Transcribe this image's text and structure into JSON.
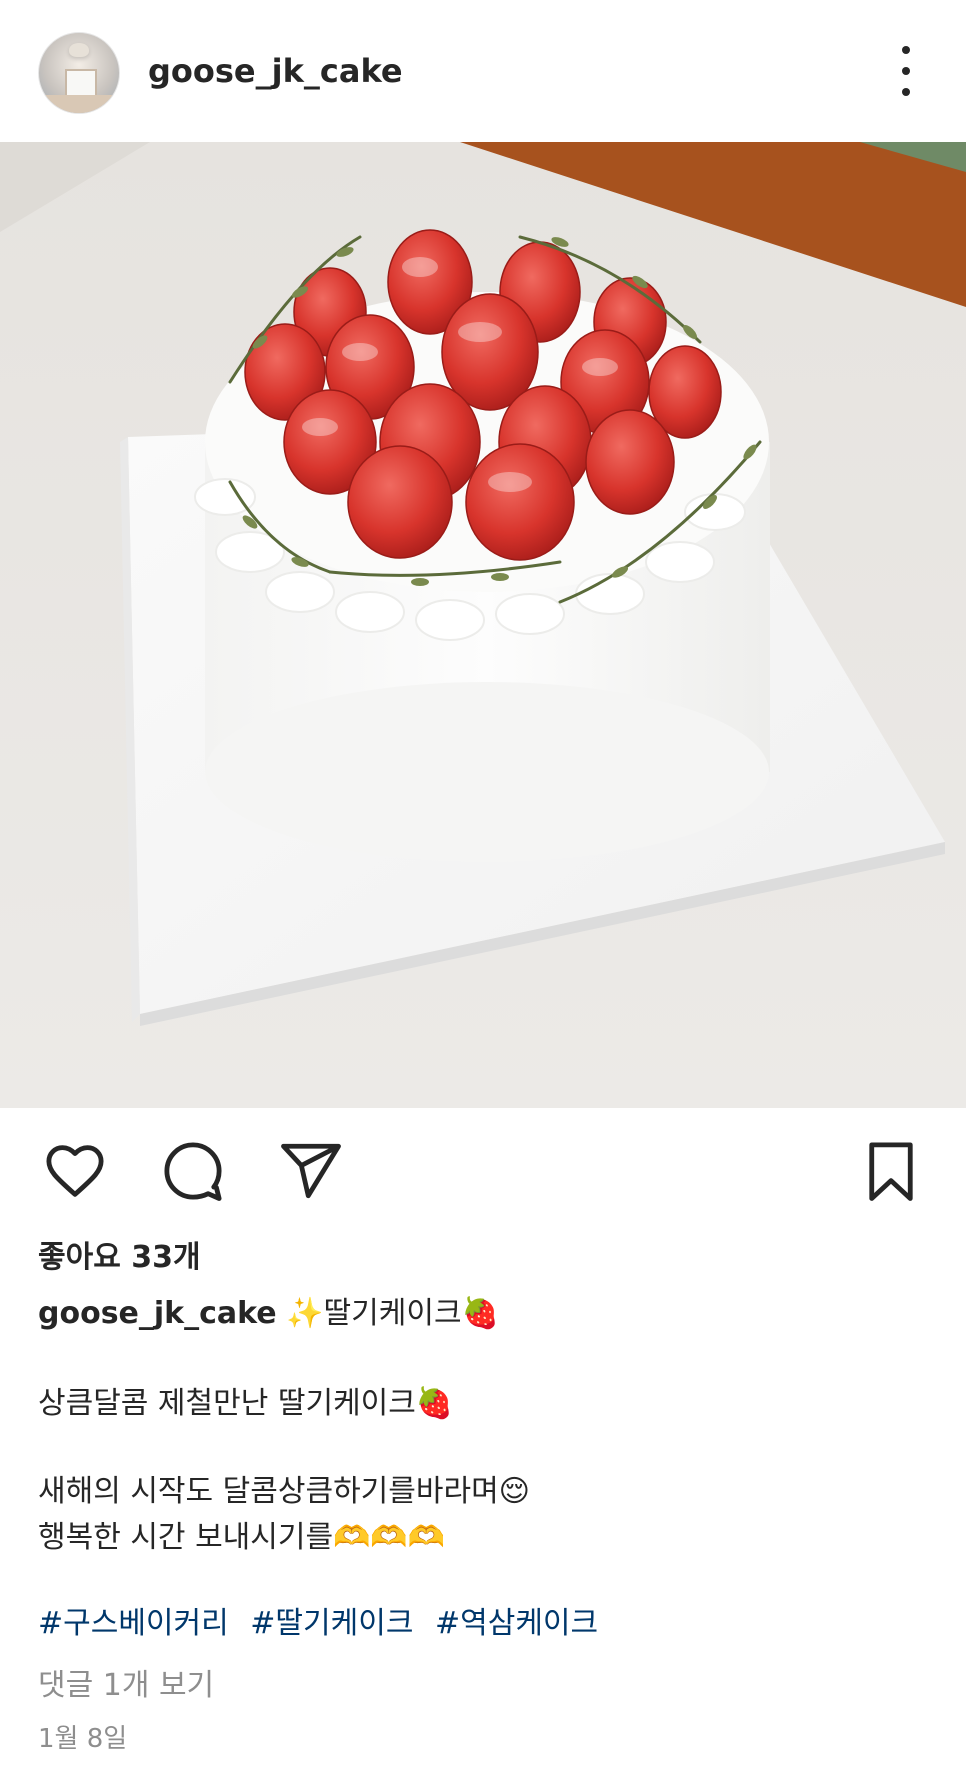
{
  "post": {
    "username": "goose_jk_cake",
    "likes_text": "좋아요 33개",
    "caption": {
      "username": "goose_jk_cake",
      "title": "✨딸기케이크🍓",
      "line1": "상큼달콤 제철만난 딸기케이크🍓",
      "line2": "새해의 시작도 달콤상큼하기를바라며😌",
      "line3": "행복한 시간 보내시기를🫶🫶🫶"
    },
    "hashtags": [
      "#구스베이커리",
      "#딸기케이크",
      "#역삼케이크"
    ],
    "comments_text": "댓글 1개 보기",
    "date_text": "1월 8일"
  },
  "icons": {
    "more": "more-vertical-icon",
    "like": "heart-icon",
    "comment": "comment-bubble-icon",
    "share": "paper-plane-icon",
    "save": "bookmark-icon"
  },
  "colors": {
    "text": "#262626",
    "muted": "#8e8e8e",
    "hashtag": "#00376b",
    "background": "#ffffff"
  }
}
